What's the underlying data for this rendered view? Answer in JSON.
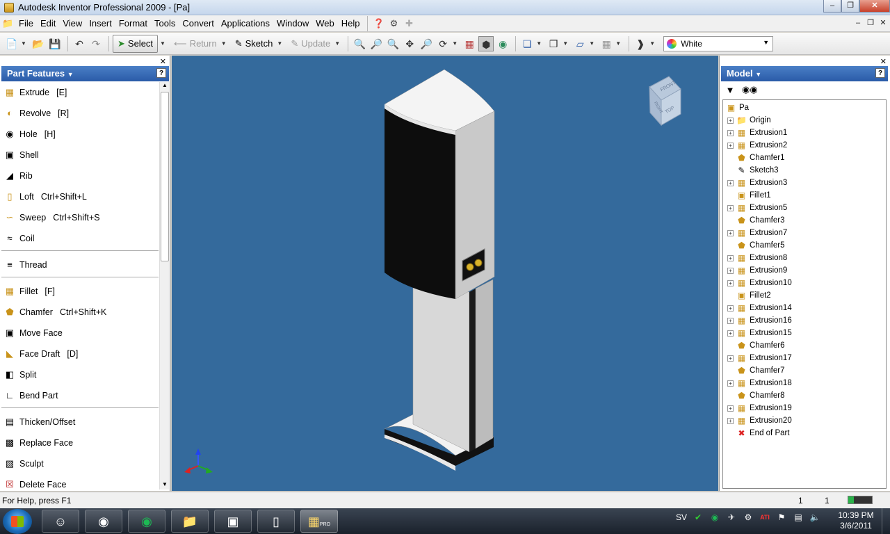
{
  "window": {
    "title": "Autodesk Inventor Professional 2009 - [Pa]"
  },
  "menu": {
    "items": [
      "File",
      "Edit",
      "View",
      "Insert",
      "Format",
      "Tools",
      "Convert",
      "Applications",
      "Window",
      "Web",
      "Help"
    ]
  },
  "toolbar": {
    "select_label": "Select",
    "return_label": "Return",
    "sketch_label": "Sketch",
    "update_label": "Update",
    "color_value": "White"
  },
  "left_panel": {
    "title": "Part Features",
    "help": "?",
    "features": [
      {
        "label": "Extrude",
        "shortcut": "[E]",
        "icon": "extrude-icon"
      },
      {
        "label": "Revolve",
        "shortcut": "[R]",
        "icon": "revolve-icon"
      },
      {
        "label": "Hole",
        "shortcut": "[H]",
        "icon": "hole-icon"
      },
      {
        "label": "Shell",
        "shortcut": "",
        "icon": "shell-icon"
      },
      {
        "label": "Rib",
        "shortcut": "",
        "icon": "rib-icon"
      },
      {
        "label": "Loft",
        "shortcut": "Ctrl+Shift+L",
        "icon": "loft-icon"
      },
      {
        "label": "Sweep",
        "shortcut": "Ctrl+Shift+S",
        "icon": "sweep-icon"
      },
      {
        "label": "Coil",
        "shortcut": "",
        "icon": "coil-icon"
      },
      {
        "label": "Thread",
        "shortcut": "",
        "icon": "thread-icon"
      },
      {
        "label": "Fillet",
        "shortcut": "[F]",
        "icon": "fillet-icon"
      },
      {
        "label": "Chamfer",
        "shortcut": "Ctrl+Shift+K",
        "icon": "chamfer-icon"
      },
      {
        "label": "Move Face",
        "shortcut": "",
        "icon": "move-face-icon"
      },
      {
        "label": "Face Draft",
        "shortcut": "[D]",
        "icon": "face-draft-icon"
      },
      {
        "label": "Split",
        "shortcut": "",
        "icon": "split-icon"
      },
      {
        "label": "Bend Part",
        "shortcut": "",
        "icon": "bend-part-icon"
      },
      {
        "label": "Thicken/Offset",
        "shortcut": "",
        "icon": "thicken-icon"
      },
      {
        "label": "Replace Face",
        "shortcut": "",
        "icon": "replace-face-icon"
      },
      {
        "label": "Sculpt",
        "shortcut": "",
        "icon": "sculpt-icon"
      },
      {
        "label": "Delete Face",
        "shortcut": "",
        "icon": "delete-face-icon"
      }
    ]
  },
  "viewcube": {
    "front": "FRONT",
    "top": "TOP",
    "right": "RIGHT"
  },
  "right_panel": {
    "title": "Model",
    "help": "?",
    "tree": [
      {
        "label": "Pa",
        "type": "part",
        "expand": false,
        "root": true
      },
      {
        "label": "Origin",
        "type": "folder",
        "expand": true
      },
      {
        "label": "Extrusion1",
        "type": "extrusion",
        "expand": true
      },
      {
        "label": "Extrusion2",
        "type": "extrusion",
        "expand": true
      },
      {
        "label": "Chamfer1",
        "type": "chamfer",
        "expand": false
      },
      {
        "label": "Sketch3",
        "type": "sketch",
        "expand": false
      },
      {
        "label": "Extrusion3",
        "type": "extrusion",
        "expand": true
      },
      {
        "label": "Fillet1",
        "type": "fillet",
        "expand": false
      },
      {
        "label": "Extrusion5",
        "type": "extrusion",
        "expand": true
      },
      {
        "label": "Chamfer3",
        "type": "chamfer",
        "expand": false
      },
      {
        "label": "Extrusion7",
        "type": "extrusion",
        "expand": true
      },
      {
        "label": "Chamfer5",
        "type": "chamfer",
        "expand": false
      },
      {
        "label": "Extrusion8",
        "type": "extrusion",
        "expand": true
      },
      {
        "label": "Extrusion9",
        "type": "extrusion",
        "expand": true
      },
      {
        "label": "Extrusion10",
        "type": "extrusion",
        "expand": true
      },
      {
        "label": "Fillet2",
        "type": "fillet",
        "expand": false
      },
      {
        "label": "Extrusion14",
        "type": "extrusion",
        "expand": true
      },
      {
        "label": "Extrusion16",
        "type": "extrusion",
        "expand": true
      },
      {
        "label": "Extrusion15",
        "type": "extrusion",
        "expand": true
      },
      {
        "label": "Chamfer6",
        "type": "chamfer",
        "expand": false
      },
      {
        "label": "Extrusion17",
        "type": "extrusion",
        "expand": true
      },
      {
        "label": "Chamfer7",
        "type": "chamfer",
        "expand": false
      },
      {
        "label": "Extrusion18",
        "type": "extrusion",
        "expand": true
      },
      {
        "label": "Chamfer8",
        "type": "chamfer",
        "expand": false
      },
      {
        "label": "Extrusion19",
        "type": "extrusion",
        "expand": true
      },
      {
        "label": "Extrusion20",
        "type": "extrusion",
        "expand": true
      },
      {
        "label": "End of Part",
        "type": "end",
        "expand": false
      }
    ]
  },
  "status": {
    "help_text": "For Help, press F1",
    "num1": "1",
    "num2": "1"
  },
  "taskbar": {
    "language": "SV",
    "time": "10:39 PM",
    "date": "3/6/2011",
    "inventor_badge": "PRO"
  },
  "colors": {
    "viewport_bg": "#346a9c",
    "panel_header": "#2a5ba8"
  }
}
